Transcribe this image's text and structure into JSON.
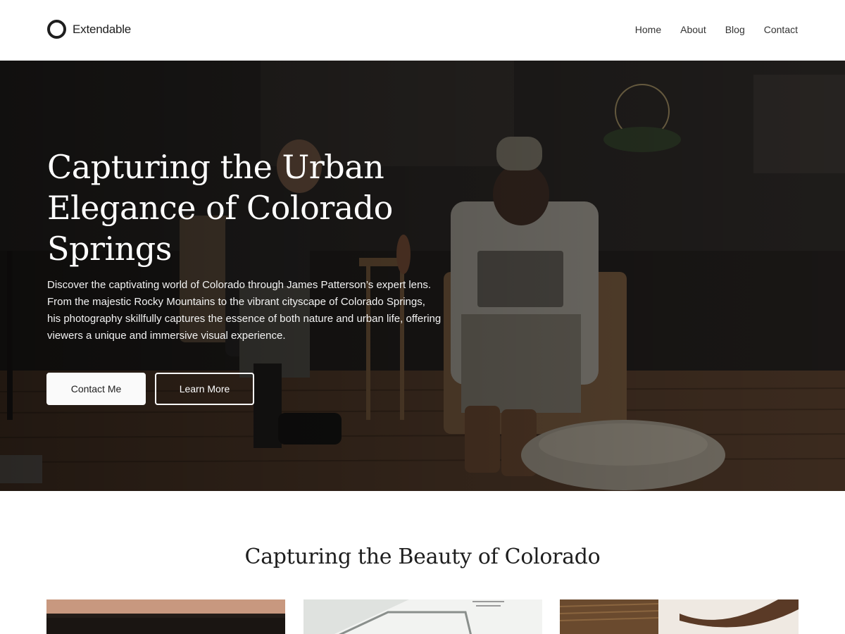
{
  "header": {
    "brand": "Extendable",
    "logo_icon": "ring-logo-icon",
    "nav": [
      {
        "label": "Home"
      },
      {
        "label": "About"
      },
      {
        "label": "Blog"
      },
      {
        "label": "Contact"
      }
    ]
  },
  "hero": {
    "title": "Capturing the Urban Elegance of Colorado Springs",
    "text": "Discover the captivating world of Colorado through James Patterson’s expert lens. From the majestic Rocky Mountains to the vibrant cityscape of Colorado Springs, his photography skillfully captures the essence of both nature and urban life, offering viewers a unique and immersive visual experience.",
    "primary_button": "Contact Me",
    "secondary_button": "Learn More"
  },
  "section": {
    "title": "Capturing the Beauty of Colorado"
  },
  "colors": {
    "text": "#1e1e1e",
    "background": "#ffffff",
    "hero_text": "#ffffff"
  }
}
